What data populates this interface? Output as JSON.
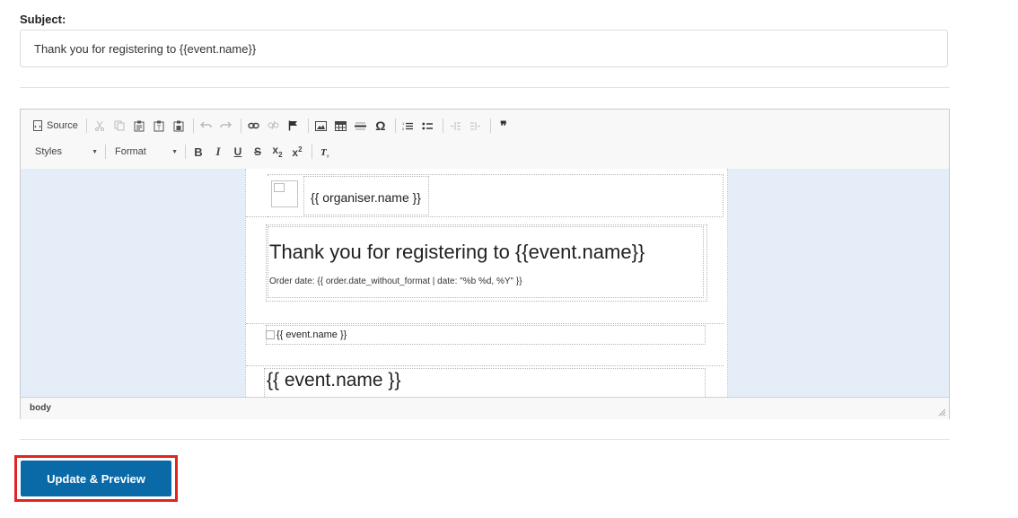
{
  "subject": {
    "label": "Subject:",
    "value": "Thank you for registering to {{event.name}}"
  },
  "toolbar": {
    "source_label": "Source",
    "styles_label": "Styles",
    "format_label": "Format",
    "bold_label": "B",
    "italic_label": "I",
    "underline_label": "U",
    "strike_label": "S",
    "subscript_label": "x",
    "subscript_mark": "2",
    "superscript_label": "x",
    "superscript_mark": "2",
    "omega_label": "Ω",
    "quote_label": "❞"
  },
  "email": {
    "organiser_name": "{{ organiser.name }}",
    "title": "Thank you for registering to {{event.name}}",
    "order_date": "Order date: {{ order.date_without_format | date: \"%b %d, %Y\" }}",
    "banner_alt": "{{ event.name }}",
    "event_name": "{{ event.name }}"
  },
  "statusbar": {
    "path": "body"
  },
  "actions": {
    "update_preview_label": "Update & Preview"
  },
  "colors": {
    "button_bg": "#0a6aa8",
    "highlight": "#e32222",
    "content_bg": "#e5edf9"
  }
}
